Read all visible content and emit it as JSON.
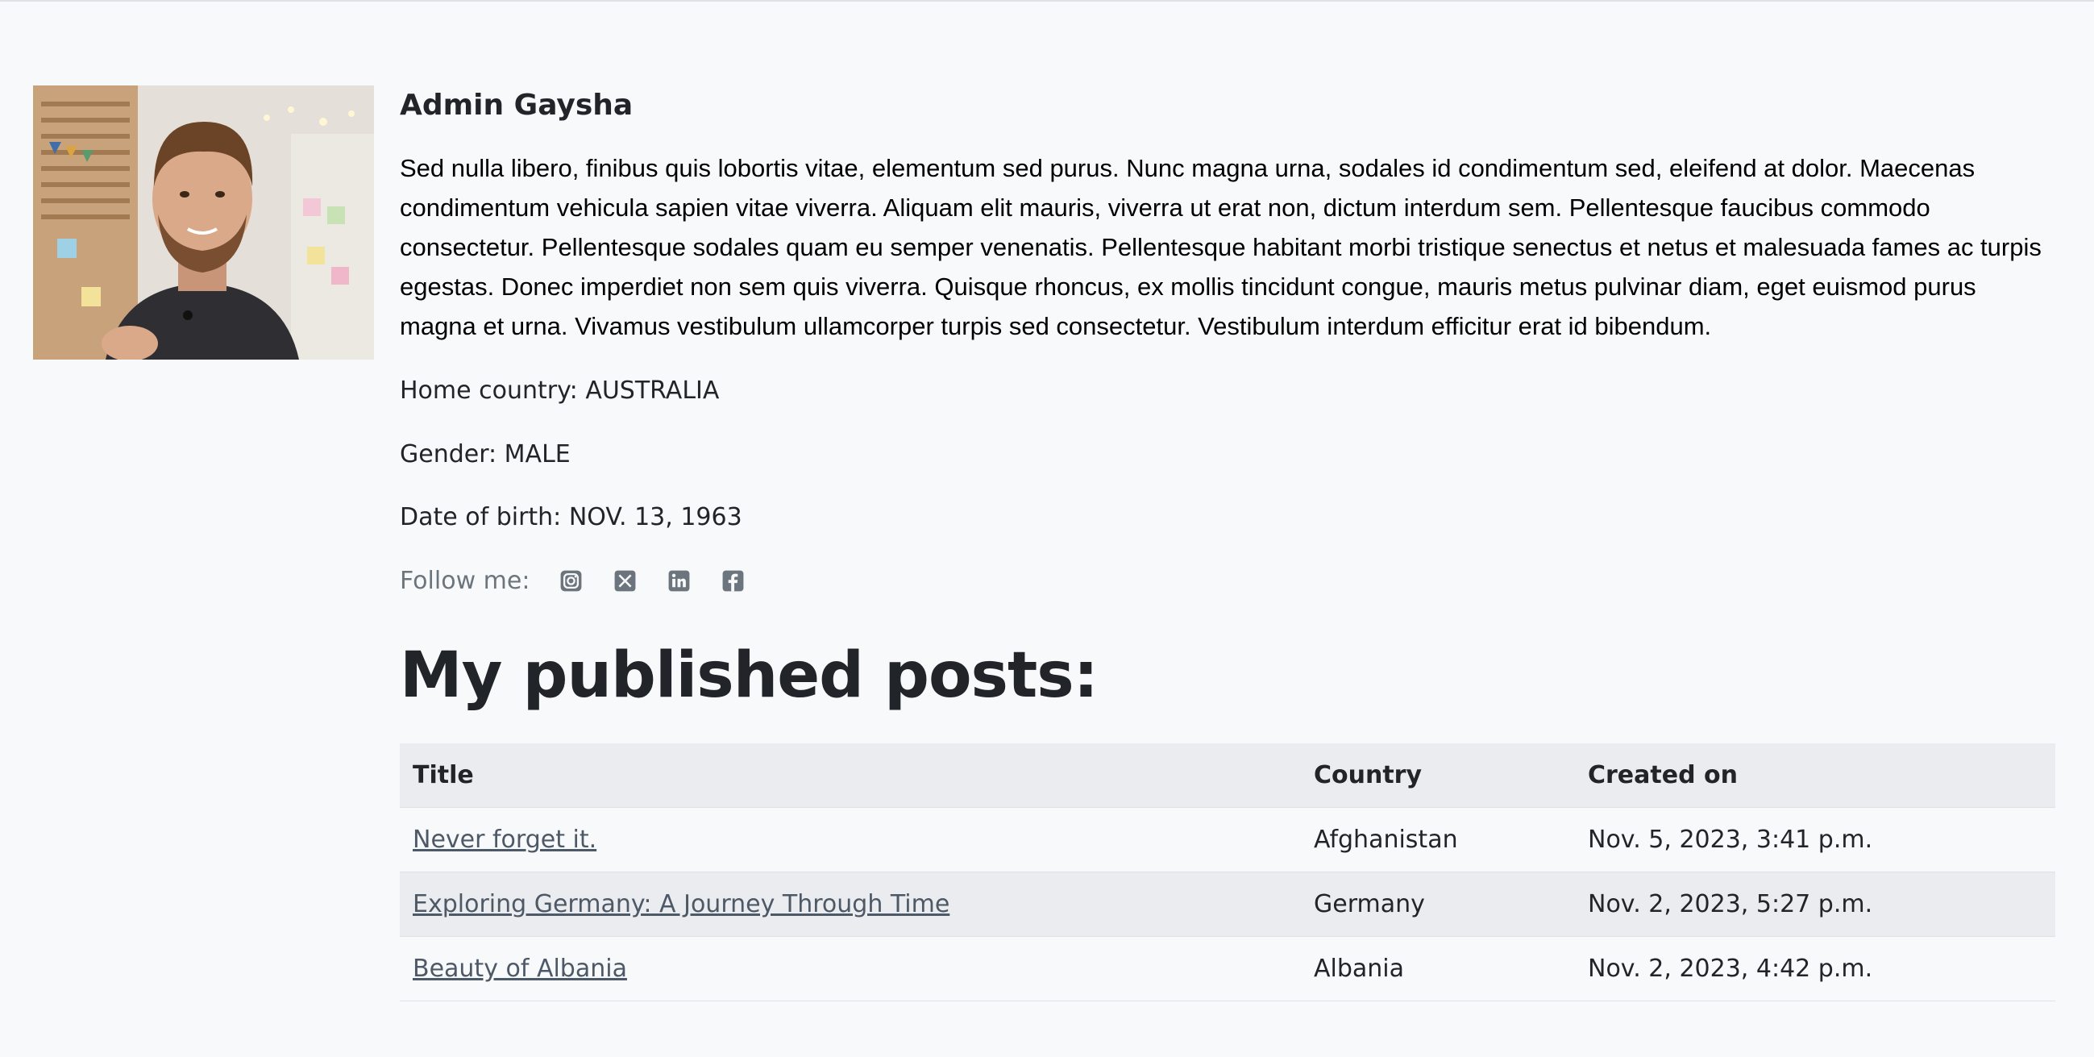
{
  "author": {
    "name": "Admin Gaysha",
    "bio": "Sed nulla libero, finibus quis lobortis vitae, elementum sed purus. Nunc magna urna, sodales id condimentum sed, eleifend at dolor. Maecenas condimentum vehicula sapien vitae viverra. Aliquam elit mauris, viverra ut erat non, dictum interdum sem. Pellentesque faucibus commodo consectetur. Pellentesque sodales quam eu semper venenatis. Pellentesque habitant morbi tristique senectus et netus et malesuada fames ac turpis egestas. Donec imperdiet non sem quis viverra. Quisque rhoncus, ex mollis tincidunt congue, mauris metus pulvinar diam, eget euismod purus magna et urna. Vivamus vestibulum ullamcorper turpis sed consectetur. Vestibulum interdum efficitur erat id bibendum.",
    "home_country": "Home country: AUSTRALIA",
    "gender": "Gender: MALE",
    "date_of_birth": "Date of birth: NOV. 13, 1963"
  },
  "follow": {
    "label": "Follow me:",
    "icons": [
      "instagram-icon",
      "x-twitter-icon",
      "linkedin-icon",
      "facebook-icon"
    ],
    "icon_color": "#6c757d"
  },
  "posts": {
    "heading": "My published posts:",
    "columns": {
      "title": "Title",
      "country": "Country",
      "created_on": "Created on"
    },
    "rows": [
      {
        "title": "Never forget it.",
        "country": "Afghanistan",
        "created_on": "Nov. 5, 2023, 3:41 p.m."
      },
      {
        "title": "Exploring Germany: A Journey Through Time",
        "country": "Germany",
        "created_on": "Nov. 2, 2023, 5:27 p.m."
      },
      {
        "title": "Beauty of Albania",
        "country": "Albania",
        "created_on": "Nov. 2, 2023, 4:42 p.m."
      }
    ]
  },
  "colors": {
    "background": "#f8f9fa",
    "striped_row": "#ebecef",
    "link": "#4d5966"
  }
}
